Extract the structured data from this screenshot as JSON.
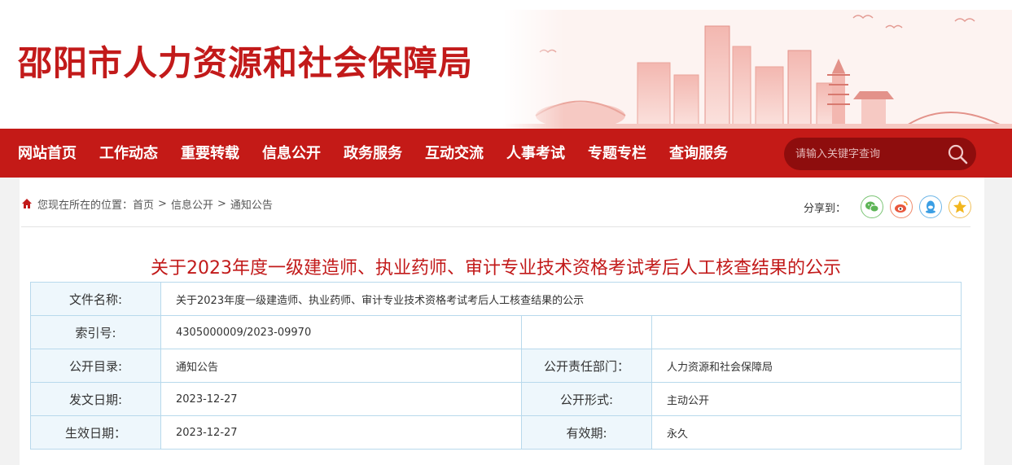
{
  "header": {
    "site_title": "邵阳市人力资源和社会保障局"
  },
  "nav": {
    "items": [
      "网站首页",
      "工作动态",
      "重要转载",
      "信息公开",
      "政务服务",
      "互动交流",
      "人事考试",
      "专题专栏",
      "查询服务"
    ],
    "search_placeholder": "请输入关键字查询"
  },
  "breadcrumb": {
    "prefix": "您现在所在的位置：",
    "items": [
      "首页",
      "信息公开",
      "通知公告"
    ],
    "separator": ">"
  },
  "share": {
    "label": "分享到：",
    "icons": [
      "wechat-icon",
      "weibo-icon",
      "qq-icon",
      "qzone-icon"
    ]
  },
  "article": {
    "title": "关于2023年度一级建造师、执业药师、审计专业技术资格考试考后人工核查结果的公示"
  },
  "meta": {
    "file_name_label": "文件名称:",
    "file_name": "关于2023年度一级建造师、执业药师、审计专业技术资格考试考后人工核查结果的公示",
    "index_label": "索引号:",
    "index_value": "4305000009/2023-09970",
    "catalog_label": "公开目录:",
    "catalog_value": "通知公告",
    "dept_label": "公开责任部门：",
    "dept_value": "人力资源和社会保障局",
    "issue_date_label": "发文日期:",
    "issue_date_value": "2023-12-27",
    "form_label": "公开形式:",
    "form_value": "主动公开",
    "effective_label": "生效日期：",
    "effective_value": "2023-12-27",
    "validity_label": "有效期:",
    "validity_value": "永久"
  },
  "colors": {
    "brand_red": "#c41a17",
    "title_red": "#c21a1a",
    "table_border": "#b8d9ec",
    "label_bg": "#eef7fc"
  }
}
